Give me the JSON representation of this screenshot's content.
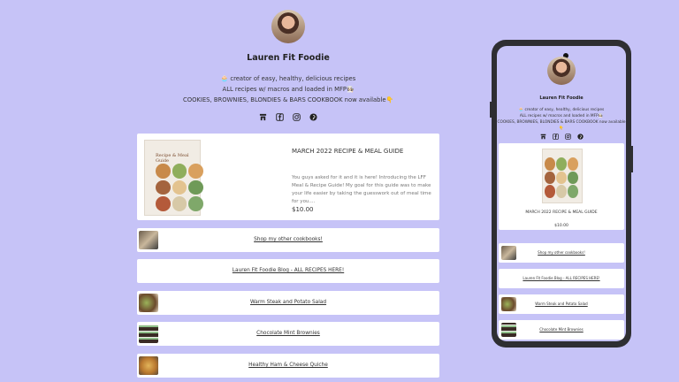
{
  "profile": {
    "name": "Lauren Fit Foodie",
    "bio_line1": "🧁 creator of easy, healthy, delicious recipes",
    "bio_line2": "ALL recipes w/ macros and loaded in MFP👩🏻‍🍳",
    "bio_line3": "COOKIES, BROWNIES, BLONDIES & BARS COOKBOOK now available👇",
    "socials": [
      "store-icon",
      "facebook-icon",
      "instagram-icon",
      "pinterest-icon"
    ]
  },
  "featured": {
    "thumb_title": "Recipe & Meal Guide",
    "title": "MARCH 2022 RECIPE & MEAL GUIDE",
    "description": "You guys asked for it and it is here! Introducing the LFF Meal & Recipe Guide! My goal for this guide was to make your life easier by taking the guesswork out of meal time for you....",
    "price": "$10.00"
  },
  "links": [
    {
      "label": "Shop my other cookbooks!",
      "has_image": true
    },
    {
      "label": "Lauren Fit Foodie Blog - ALL RECIPES HERE!",
      "has_image": false
    },
    {
      "label": "Warm Steak and Potato Salad",
      "has_image": true
    },
    {
      "label": "Chocolate Mint Brownies",
      "has_image": true
    },
    {
      "label": "Healthy Ham & Cheese Quiche",
      "has_image": true
    }
  ],
  "colors": {
    "background": "#c6c3f7",
    "card": "#ffffff",
    "phone_frame": "#2e2e32"
  }
}
